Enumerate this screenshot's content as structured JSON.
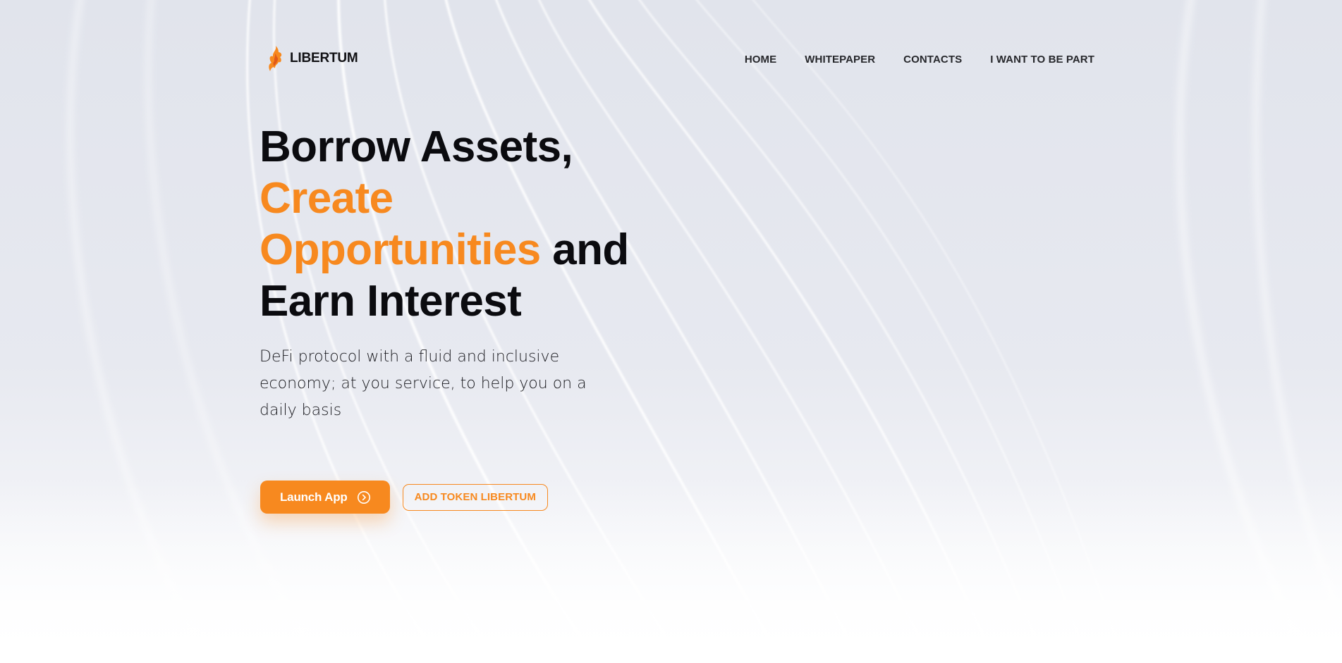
{
  "brand": {
    "name": "LIBERTUM",
    "accent_color": "#f7891f",
    "logo_icon": "flame-logo-icon"
  },
  "nav": {
    "items": [
      {
        "label": "HOME"
      },
      {
        "label": "WHITEPAPER"
      },
      {
        "label": "CONTACTS"
      },
      {
        "label": "I WANT TO BE PART"
      }
    ]
  },
  "hero": {
    "headline": {
      "part1": "Borrow Assets,",
      "part2_highlight_line1": "Create",
      "part3_highlight_line2": "Opportunities",
      "part4": "and",
      "part5": "Earn Interest"
    },
    "subtitle": "DeFi protocol with a fluid and inclusive economy; at you service, to help you on a daily basis"
  },
  "actions": {
    "launch_label": "Launch App",
    "launch_icon": "chevron-right-circle-icon",
    "add_token_label": "ADD TOKEN LIBERTUM"
  }
}
